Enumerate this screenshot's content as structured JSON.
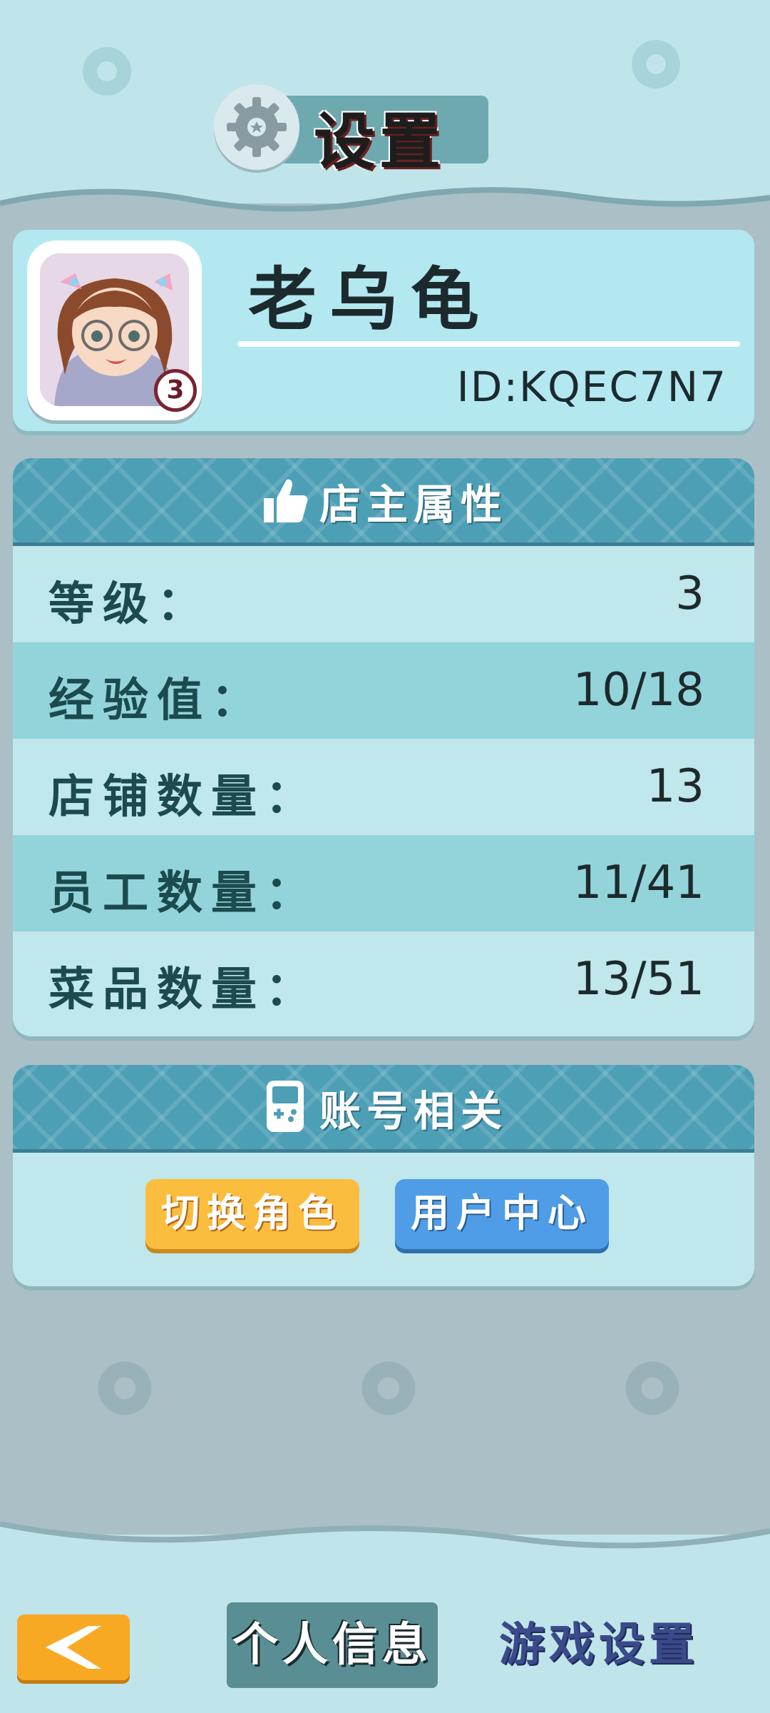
{
  "header": {
    "title": "设置",
    "icon": "gear-icon"
  },
  "profile": {
    "name": "老乌龟",
    "id_text": "ID:KQEC7N7",
    "level_badge": "3",
    "avatar": "avatar-portrait"
  },
  "owner_stats": {
    "title": "店主属性",
    "icon": "thumbs-up-icon",
    "rows": [
      {
        "label": "等级：",
        "value": "3"
      },
      {
        "label": "经验值：",
        "value": "10/18"
      },
      {
        "label": "店铺数量：",
        "value": "13"
      },
      {
        "label": "员工数量：",
        "value": "11/41"
      },
      {
        "label": "菜品数量：",
        "value": "13/51"
      }
    ]
  },
  "account": {
    "title": "账号相关",
    "icon": "gamepad-icon",
    "buttons": {
      "switch_role": "切换角色",
      "user_center": "用户中心"
    }
  },
  "bottom_nav": {
    "back_icon": "chevron-left-icon",
    "tab_profile": "个人信息",
    "tab_game_settings": "游戏设置"
  },
  "colors": {
    "accent_orange": "#fbbd3d",
    "accent_blue": "#4f9de6",
    "panel_header": "#4d9fb6",
    "background_top": "#bfe5ea"
  }
}
